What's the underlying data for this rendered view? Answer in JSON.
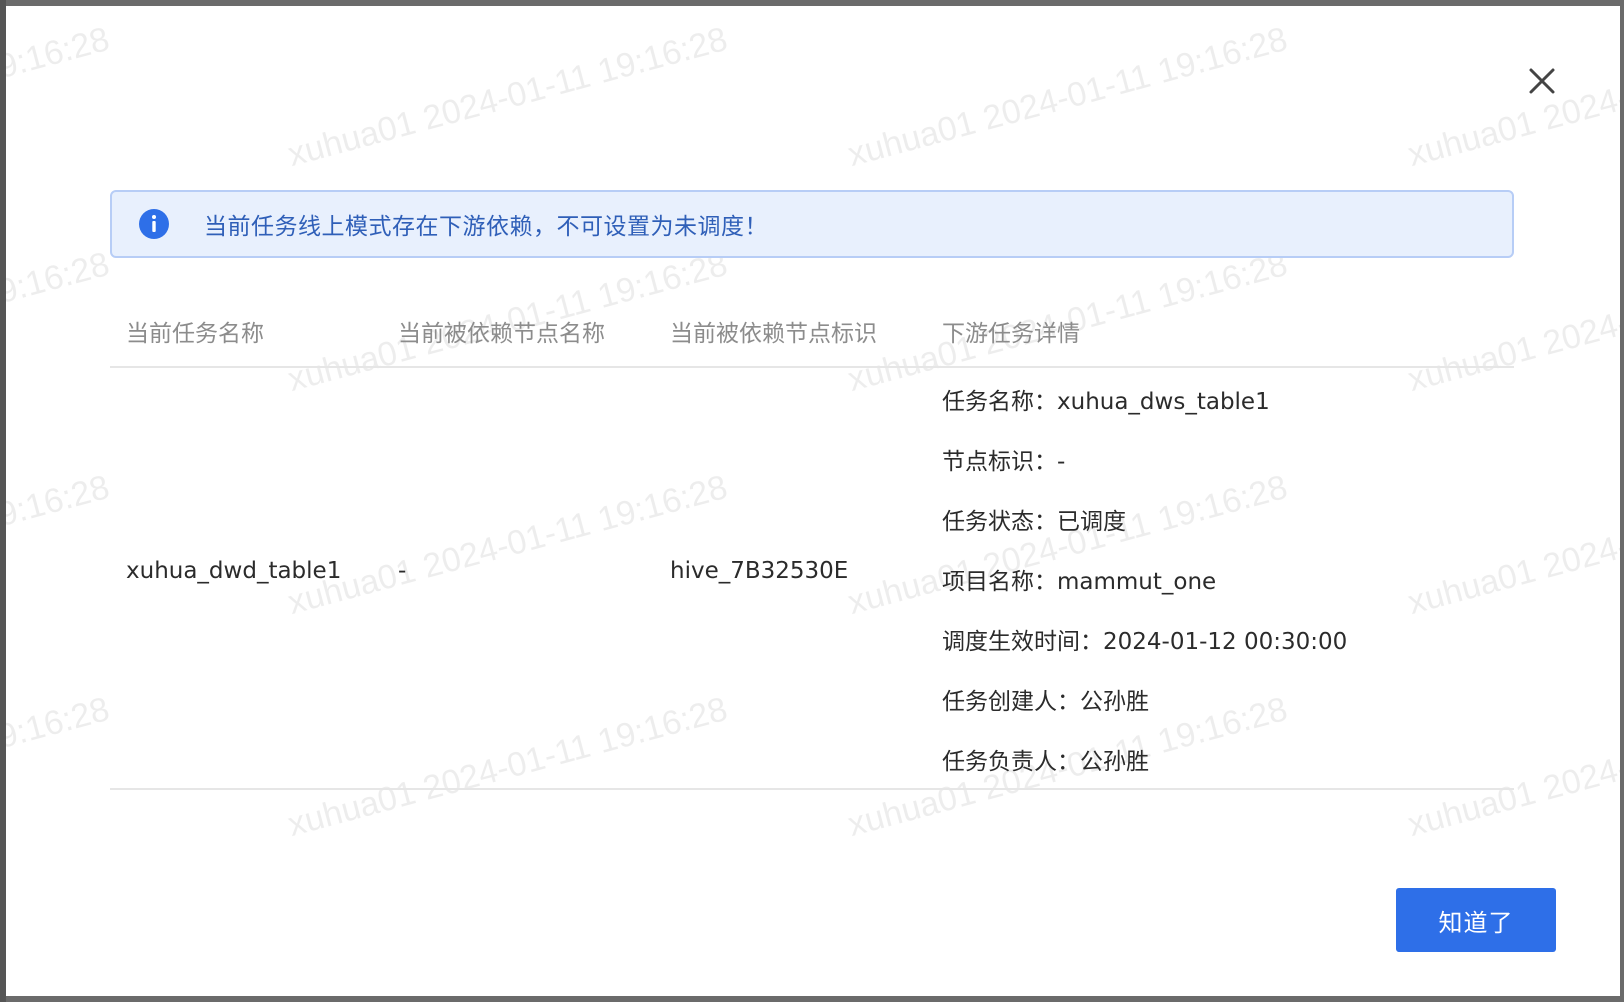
{
  "watermark": {
    "text": "xuhua01 2024-01-11 19:16:28"
  },
  "alert": {
    "icon": "info-icon",
    "message": "当前任务线上模式存在下游依赖，不可设置为未调度！"
  },
  "table": {
    "columns": [
      "当前任务名称",
      "当前被依赖节点名称",
      "当前被依赖节点标识",
      "下游任务详情"
    ],
    "rows": [
      {
        "task_name": "xuhua_dwd_table1",
        "node_name": "-",
        "node_id": "hive_7B32530E",
        "details": [
          "任务名称：xuhua_dws_table1",
          "节点标识：-",
          "任务状态：已调度",
          "项目名称：mammut_one",
          "调度生效时间：2024-01-12 00:30:00",
          "任务创建人：公孙胜",
          "任务负责人：公孙胜"
        ]
      }
    ]
  },
  "footer": {
    "ok_label": "知道了"
  },
  "colors": {
    "primary": "#2e6fe8",
    "alert_bg": "#e8f0fd",
    "alert_border": "#b7cdf6",
    "alert_text": "#2f5fb8"
  }
}
